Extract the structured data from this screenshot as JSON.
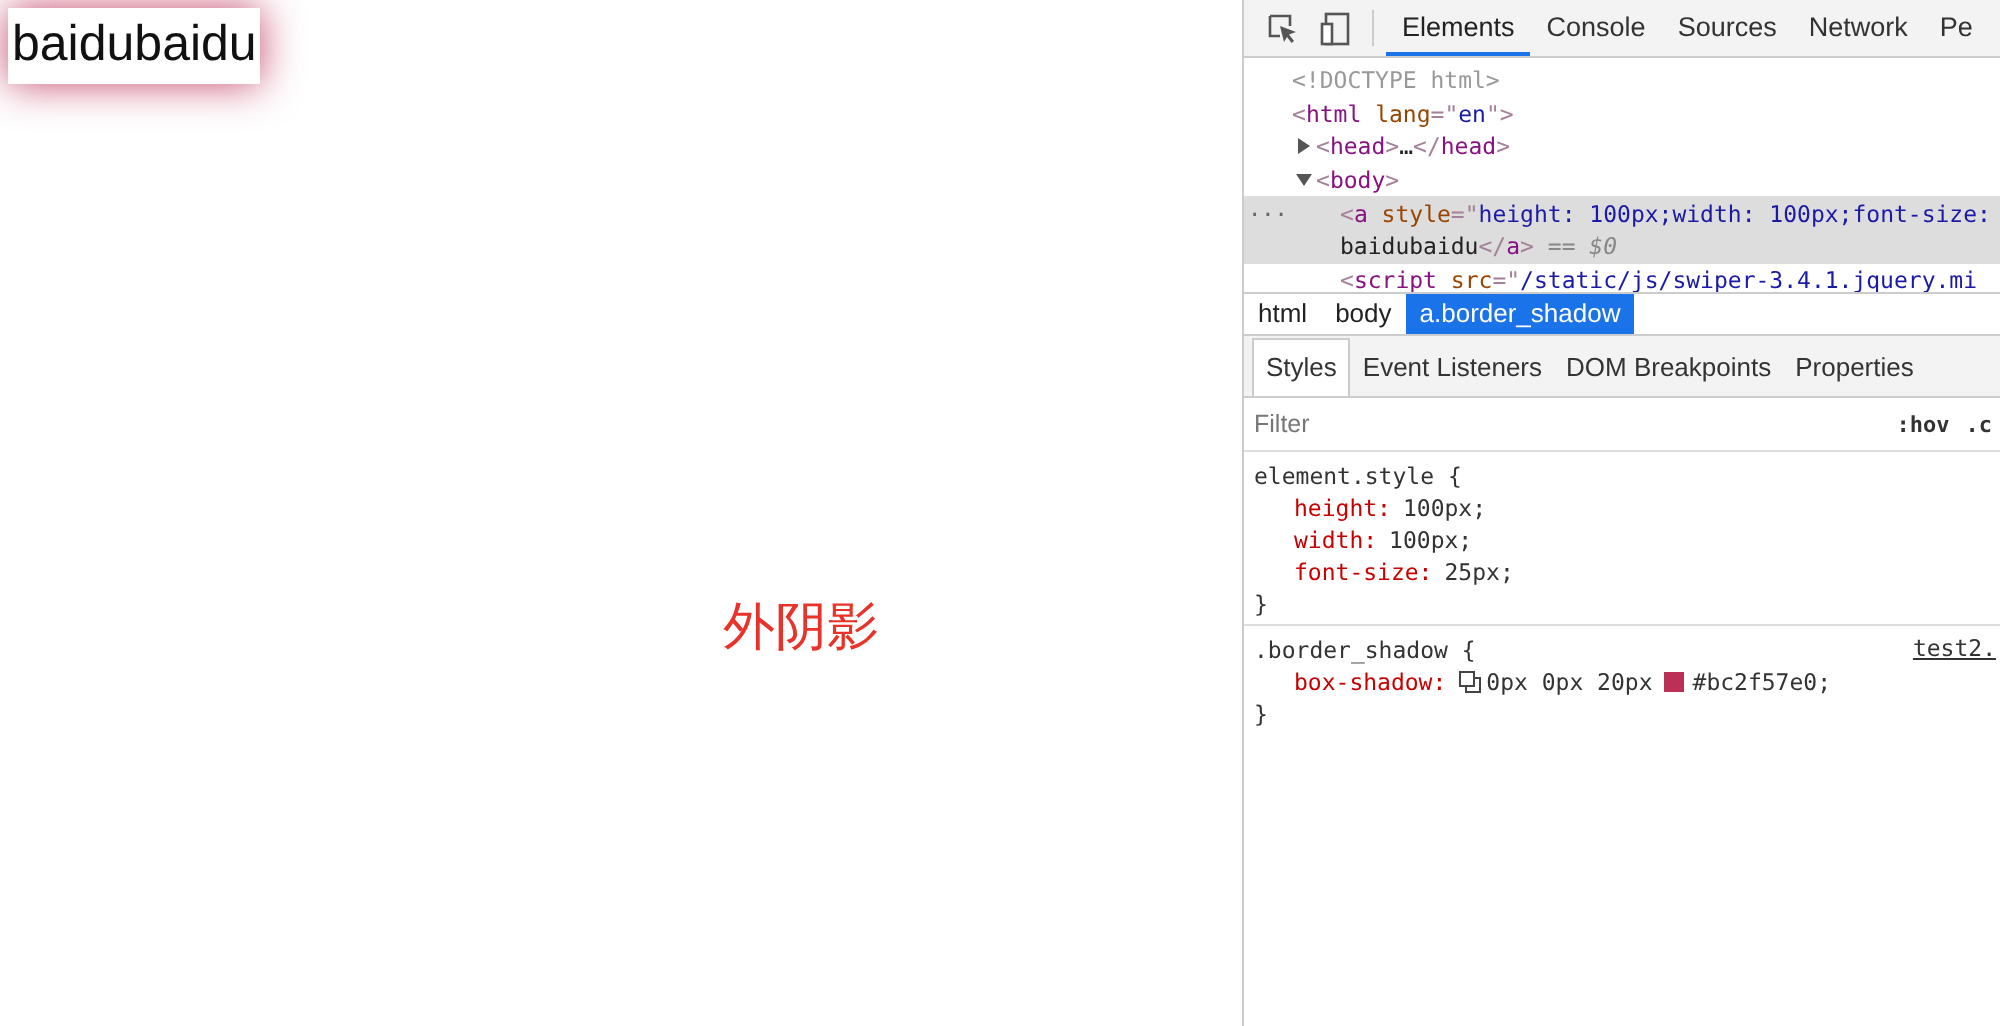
{
  "page": {
    "link_text": "baidubaidu",
    "caption": "外阴影"
  },
  "devtools": {
    "toolbar": {
      "tabs": [
        {
          "label": "Elements",
          "selected": true
        },
        {
          "label": "Console",
          "selected": false
        },
        {
          "label": "Sources",
          "selected": false
        },
        {
          "label": "Network",
          "selected": false
        },
        {
          "label": "Pe",
          "selected": false
        }
      ]
    },
    "dom_tree": [
      {
        "lines": [
          [
            {
              "kind": "doctype",
              "text": "<!DOCTYPE html>"
            }
          ]
        ],
        "selected": false
      },
      {
        "lines": [
          [
            {
              "kind": "punct",
              "text": "<"
            },
            {
              "kind": "tag",
              "text": "html"
            },
            {
              "kind": "attr",
              "text": "lang"
            },
            {
              "kind": "punct",
              "text": "=\""
            },
            {
              "kind": "value",
              "text": "en"
            },
            {
              "kind": "punct",
              "text": "\">"
            }
          ]
        ],
        "selected": false,
        "children": [
          {
            "lines": [
              [
                {
                  "kind": "punct",
                  "text": "<"
                },
                {
                  "kind": "tag",
                  "text": "head"
                },
                {
                  "kind": "punct",
                  "text": ">"
                },
                {
                  "kind": "text",
                  "text": "…"
                },
                {
                  "kind": "punct",
                  "text": "</"
                },
                {
                  "kind": "tag",
                  "text": "head"
                },
                {
                  "kind": "punct",
                  "text": ">"
                }
              ]
            ],
            "expanded": false,
            "selected": false
          },
          {
            "lines": [
              [
                {
                  "kind": "punct",
                  "text": "<"
                },
                {
                  "kind": "tag",
                  "text": "body"
                },
                {
                  "kind": "punct",
                  "text": ">"
                }
              ]
            ],
            "expanded": true,
            "selected": false,
            "children": [
              {
                "lines": [
                  [
                    {
                      "kind": "punct",
                      "text": "<"
                    },
                    {
                      "kind": "tag",
                      "text": "a"
                    },
                    {
                      "kind": "attr",
                      "text": "style"
                    },
                    {
                      "kind": "punct",
                      "text": "=\""
                    },
                    {
                      "kind": "value",
                      "text": "height: 100px;width: 100px;font-size:"
                    }
                  ],
                  [
                    {
                      "kind": "text",
                      "text": "baidubaidu"
                    },
                    {
                      "kind": "punct",
                      "text": "</"
                    },
                    {
                      "kind": "tag",
                      "text": "a"
                    },
                    {
                      "kind": "punct",
                      "text": ">"
                    },
                    {
                      "kind": "marker",
                      "text": " == $0"
                    }
                  ]
                ],
                "selected": true,
                "gutter": "..."
              },
              {
                "lines": [
                  [
                    {
                      "kind": "punct",
                      "text": "<"
                    },
                    {
                      "kind": "tag",
                      "text": "script"
                    },
                    {
                      "kind": "attr",
                      "text": "src"
                    },
                    {
                      "kind": "punct",
                      "text": "=\""
                    },
                    {
                      "kind": "value",
                      "text": "/static/js/swiper-3.4.1.jquery.mi"
                    }
                  ]
                ],
                "selected": false
              }
            ]
          }
        ]
      }
    ],
    "breadcrumbs": [
      {
        "label": "html",
        "selected": false
      },
      {
        "label": "body",
        "selected": false
      },
      {
        "label": "a.border_shadow",
        "selected": true
      }
    ],
    "sidebar_tabs": [
      {
        "label": "Styles",
        "selected": true
      },
      {
        "label": "Event Listeners",
        "selected": false
      },
      {
        "label": "DOM Breakpoints",
        "selected": false
      },
      {
        "label": "Properties",
        "selected": false
      }
    ],
    "filter": {
      "placeholder": "Filter",
      "buttons": [
        ":hov",
        ".c"
      ]
    },
    "rules": [
      {
        "selector": "element.style",
        "open": "{",
        "close": "}",
        "properties": [
          {
            "name": "height:",
            "value": "100px;"
          },
          {
            "name": "width:",
            "value": "100px;"
          },
          {
            "name": "font-size:",
            "value": "25px;"
          }
        ]
      },
      {
        "selector": ".border_shadow",
        "source": "test2.",
        "open": "{",
        "close": "}",
        "properties": [
          {
            "name": "box-shadow:",
            "shadow_editor": true,
            "value_prefix": "0px 0px 20px",
            "color": "#bc2f57",
            "value": "#bc2f57e0;"
          }
        ]
      }
    ]
  }
}
